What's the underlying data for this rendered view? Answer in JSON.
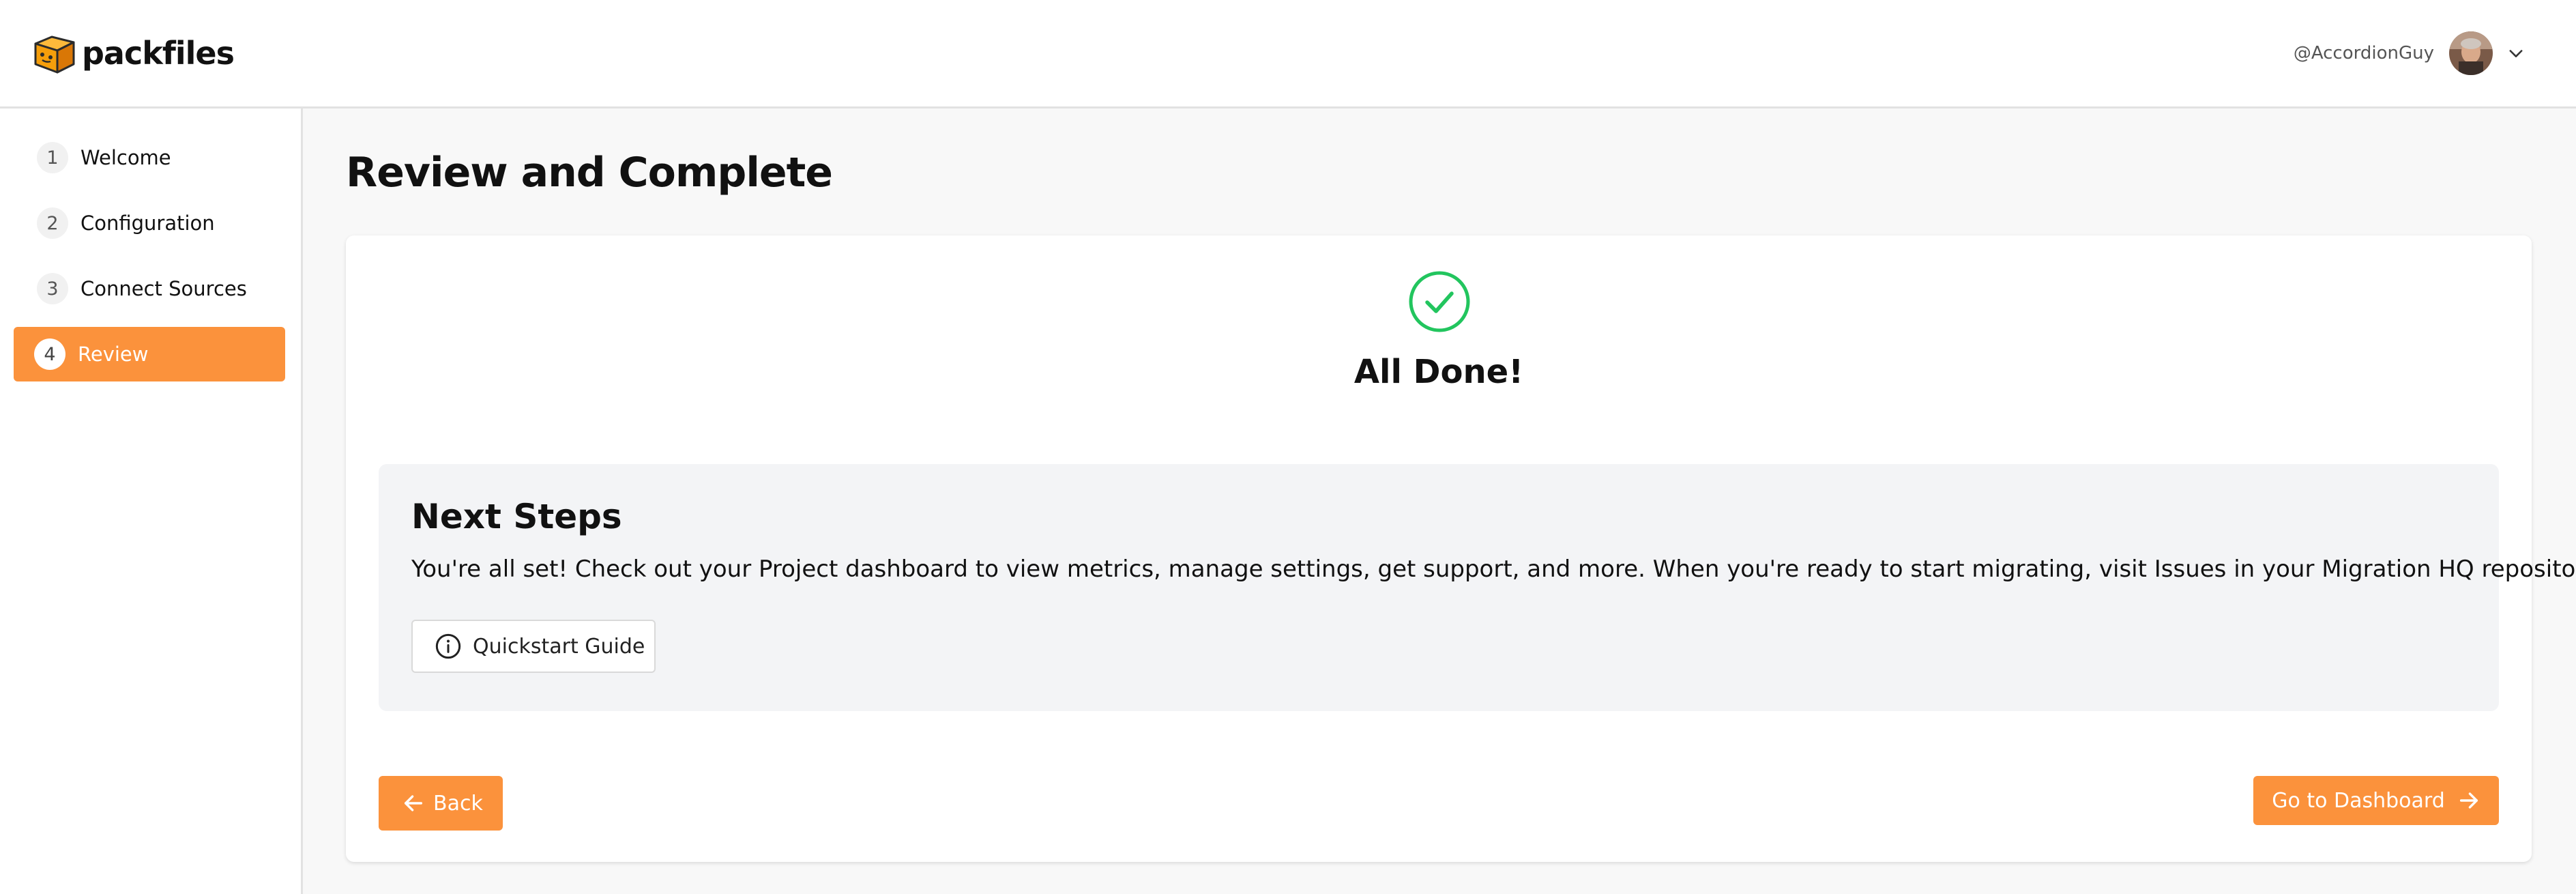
{
  "brand": {
    "name": "packfiles",
    "accent": "#fb923c"
  },
  "user": {
    "handle": "@AccordionGuy"
  },
  "sidebar": {
    "steps": [
      {
        "num": "1",
        "label": "Welcome"
      },
      {
        "num": "2",
        "label": "Configuration"
      },
      {
        "num": "3",
        "label": "Connect Sources"
      },
      {
        "num": "4",
        "label": "Review",
        "active": true
      }
    ]
  },
  "main": {
    "title": "Review and Complete",
    "status": {
      "icon": "check-circle-icon",
      "title": "All Done!",
      "color": "#22c55e"
    },
    "next_steps": {
      "title": "Next Steps",
      "text": "You're all set! Check out your Project dashboard to view metrics, manage settings, get support, and more. When you're ready to start migrating, visit Issues in your Migration HQ repository.",
      "quickstart_label": "Quickstart Guide"
    },
    "back_label": "Back",
    "dashboard_label": "Go to Dashboard"
  }
}
